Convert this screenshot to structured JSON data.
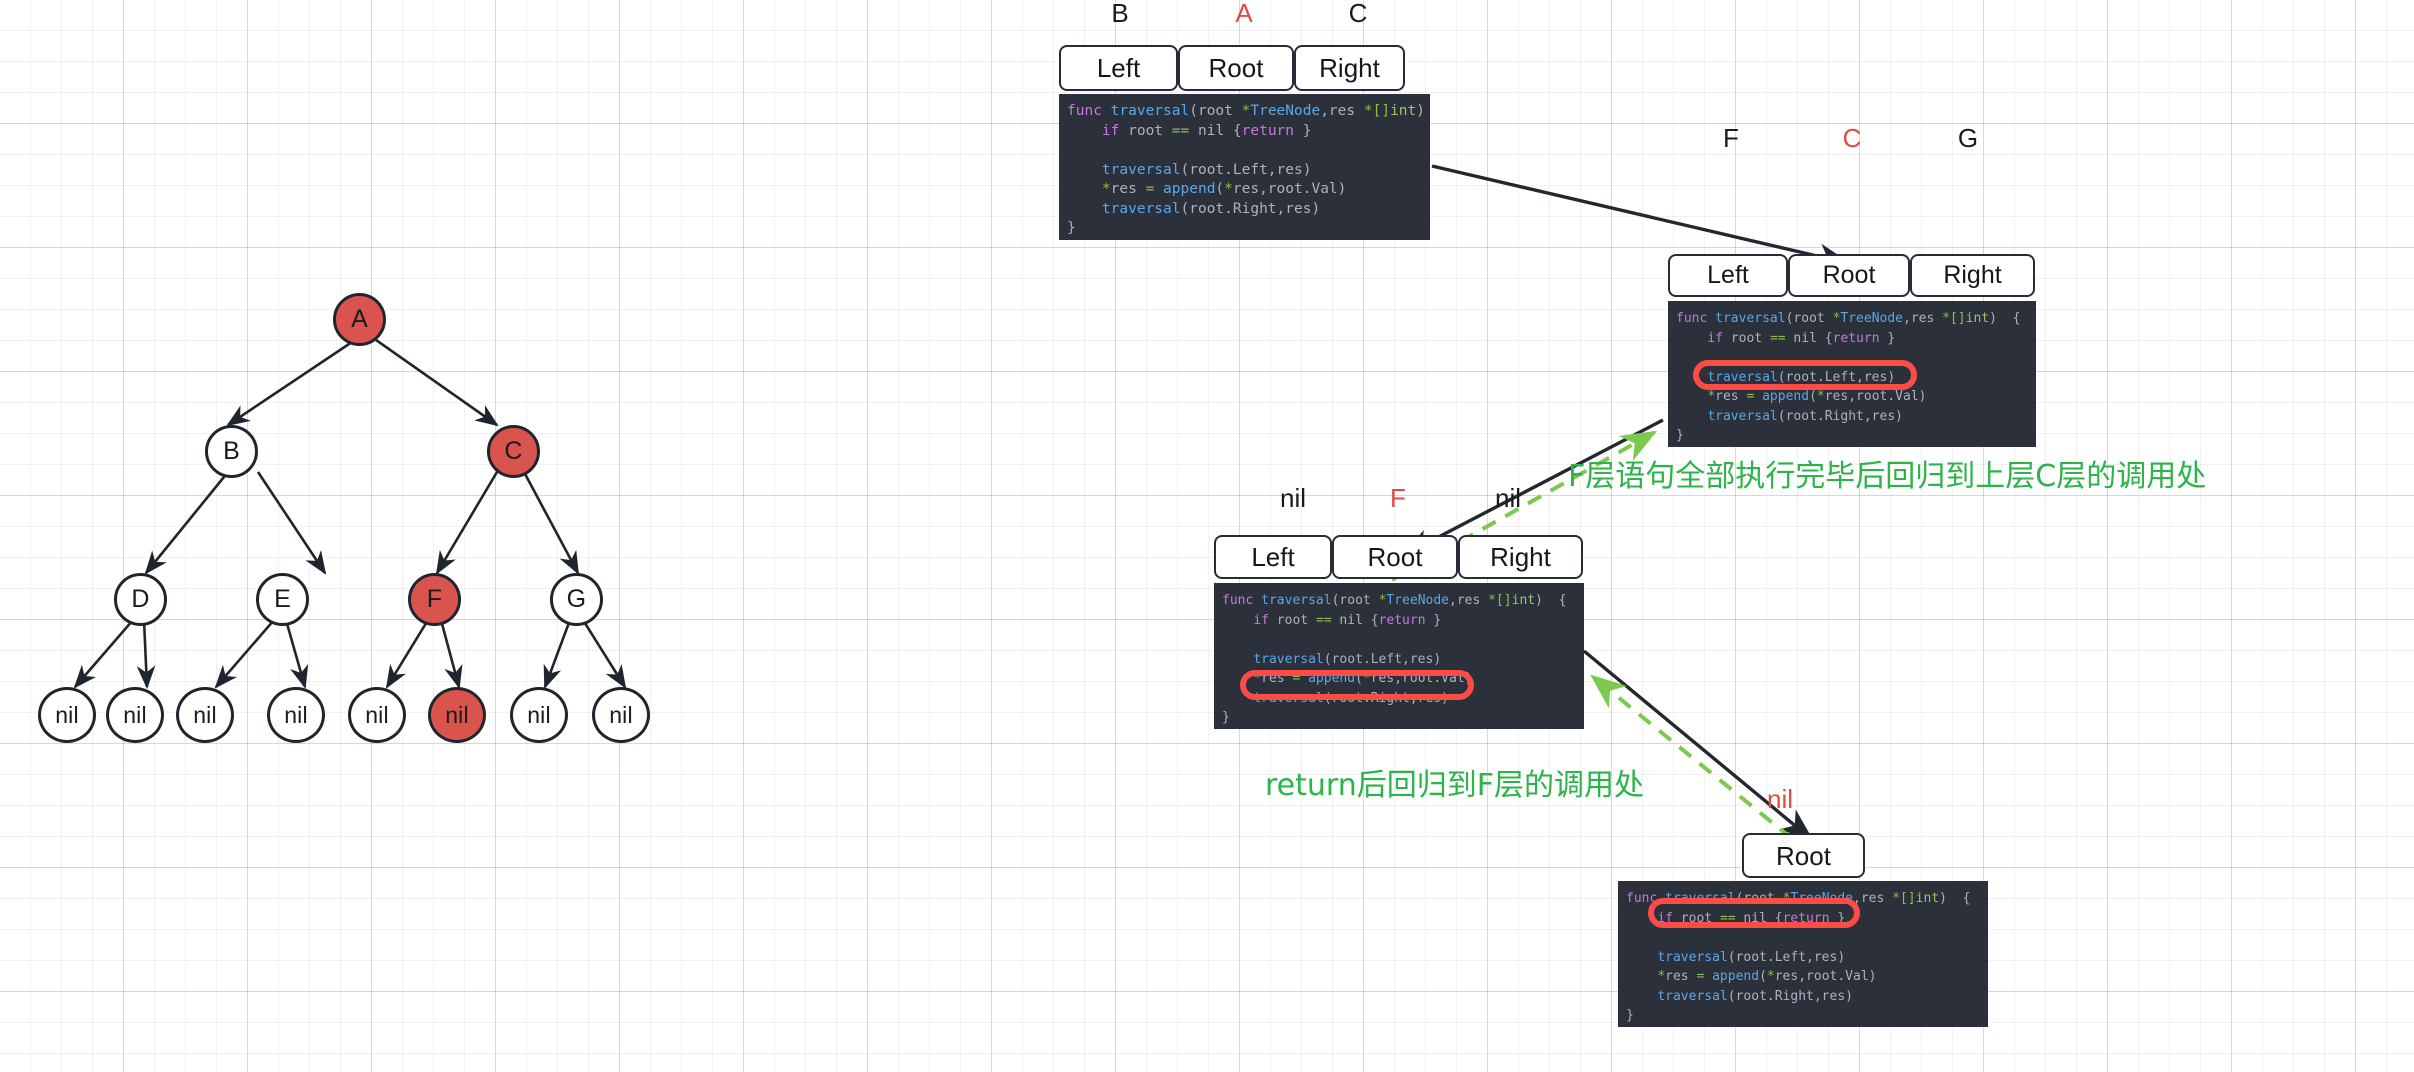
{
  "canvas": {
    "background": "#ffffff",
    "grid_minor_color": "#e9e9e9",
    "grid_major_color": "#dcdcdc",
    "accent_red": "#d9544d",
    "accent_green": "#2cb34a",
    "highlight_red": "#fb4d45",
    "code_bg": "#2b303b"
  },
  "tree": {
    "nodes": [
      {
        "id": "A",
        "label": "A",
        "highlighted": true
      },
      {
        "id": "B",
        "label": "B",
        "highlighted": false
      },
      {
        "id": "C",
        "label": "C",
        "highlighted": true
      },
      {
        "id": "D",
        "label": "D",
        "highlighted": false
      },
      {
        "id": "E",
        "label": "E",
        "highlighted": false
      },
      {
        "id": "F",
        "label": "F",
        "highlighted": true
      },
      {
        "id": "G",
        "label": "G",
        "highlighted": false
      },
      {
        "id": "D_L",
        "label": "nil",
        "highlighted": false
      },
      {
        "id": "D_R",
        "label": "nil",
        "highlighted": false
      },
      {
        "id": "E_L",
        "label": "nil",
        "highlighted": false
      },
      {
        "id": "E_R",
        "label": "nil",
        "highlighted": false
      },
      {
        "id": "F_L",
        "label": "nil",
        "highlighted": false
      },
      {
        "id": "F_R",
        "label": "nil",
        "highlighted": true
      },
      {
        "id": "G_L",
        "label": "nil",
        "highlighted": false
      },
      {
        "id": "G_R",
        "label": "nil",
        "highlighted": false
      }
    ],
    "edges": [
      {
        "from": "A",
        "to": "B"
      },
      {
        "from": "A",
        "to": "C"
      },
      {
        "from": "B",
        "to": "D"
      },
      {
        "from": "B",
        "to": "E"
      },
      {
        "from": "C",
        "to": "F"
      },
      {
        "from": "C",
        "to": "G"
      },
      {
        "from": "D",
        "to": "D_L"
      },
      {
        "from": "D",
        "to": "D_R"
      },
      {
        "from": "E",
        "to": "E_L"
      },
      {
        "from": "E",
        "to": "E_R"
      },
      {
        "from": "F",
        "to": "F_L"
      },
      {
        "from": "F",
        "to": "F_R"
      },
      {
        "from": "G",
        "to": "G_L"
      },
      {
        "from": "G",
        "to": "G_R"
      }
    ]
  },
  "code_snippet": {
    "line1": {
      "kw": "func",
      "fn": "traversal",
      "p1": "(root ",
      "op1": "*",
      "ty1": "TreeNode",
      "p2": ",res ",
      "op2": "*[]",
      "ty2": "int",
      "p3": ")  {"
    },
    "line2": {
      "kw": "if",
      "p1": " root ",
      "op": "==",
      "p2": " nil {",
      "kw2": "return",
      "p3": " }"
    },
    "line4": {
      "fn": "traversal",
      "p1": "(root.Left,res)"
    },
    "line5": {
      "op1": "*",
      "p1": "res ",
      "op2": "=",
      "fn": " append",
      "p2": "(",
      "op3": "*",
      "p3": "res,root.Val)"
    },
    "line6": {
      "fn": "traversal",
      "p1": "(root.Right,res)"
    },
    "line7": {
      "p1": "}"
    }
  },
  "frames": [
    {
      "id": "frame-a",
      "labels": [
        {
          "text": "B",
          "color": "black"
        },
        {
          "text": "A",
          "color": "red"
        },
        {
          "text": "C",
          "color": "black"
        }
      ],
      "slots": [
        "Left",
        "Root",
        "Right"
      ],
      "highlighted_line": null
    },
    {
      "id": "frame-c",
      "labels": [
        {
          "text": "F",
          "color": "black"
        },
        {
          "text": "C",
          "color": "red"
        },
        {
          "text": "G",
          "color": "black"
        }
      ],
      "slots": [
        "Left",
        "Root",
        "Right"
      ],
      "highlighted_line": "traversal(root.Left,res)"
    },
    {
      "id": "frame-f",
      "labels": [
        {
          "text": "nil",
          "color": "black"
        },
        {
          "text": "F",
          "color": "red"
        },
        {
          "text": "nil",
          "color": "black"
        }
      ],
      "slots": [
        "Left",
        "Root",
        "Right"
      ],
      "highlighted_line": "traversal(root.Right,res)"
    },
    {
      "id": "frame-nil",
      "labels": [
        {
          "text": "nil",
          "color": "red"
        }
      ],
      "slots": [
        "Root"
      ],
      "highlighted_line": "if root == nil {return }"
    }
  ],
  "annotations": {
    "note_return_to_c": "F层语句全部执行完毕后回归到上层C层的调用处",
    "note_return_to_f": "return后回归到F层的调用处"
  }
}
